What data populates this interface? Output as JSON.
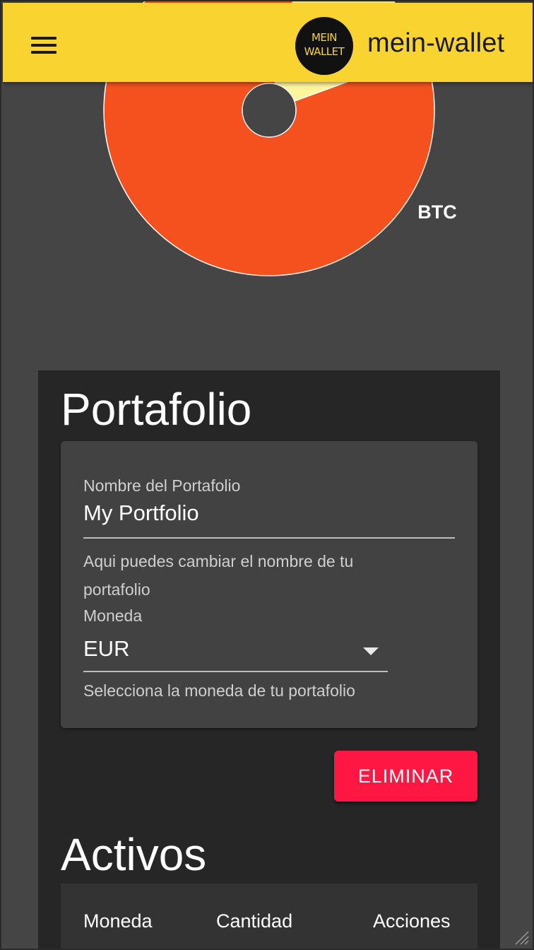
{
  "header": {
    "menu_icon": "hamburger-menu-icon",
    "logo": {
      "line1": "MEIN",
      "line2": "WALLET"
    },
    "title": "mein-wallet"
  },
  "chart_data": {
    "type": "pie",
    "donut": true,
    "slices": [
      {
        "label": "BTC",
        "value": 84,
        "color": "#f4511e"
      },
      {
        "label": "",
        "value": 16,
        "color": "#fff59d"
      }
    ],
    "visible_labels": [
      "BTC"
    ]
  },
  "portfolio": {
    "title": "Portafolio",
    "name_label": "Nombre del Portafolio",
    "name_value": "My Portfolio",
    "name_hint_line1": "Aqui puedes cambiar el nombre de tu",
    "name_hint_line2": "portafolio",
    "currency_label": "Moneda",
    "currency_value": "EUR",
    "currency_hint": "Selecciona la moneda de tu portafolio",
    "delete_label": "ELIMINAR"
  },
  "assets": {
    "title": "Activos",
    "columns": [
      "Moneda",
      "Cantidad",
      "Acciones"
    ]
  },
  "colors": {
    "appbar": "#f9d431",
    "accent_red": "#ff1744",
    "card_bg": "#262626",
    "panel_bg": "#424242"
  }
}
